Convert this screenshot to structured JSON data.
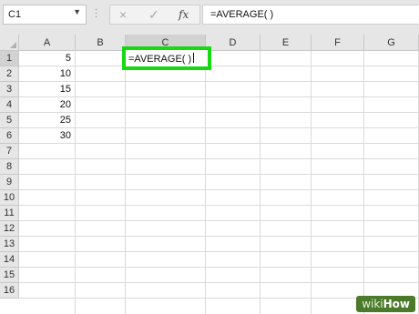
{
  "name_box": {
    "value": "C1"
  },
  "formula_bar": {
    "cancel_icon": "×",
    "enter_icon": "✓",
    "function_icon": "fx",
    "value": "=AVERAGE( )"
  },
  "columns": [
    "A",
    "B",
    "C",
    "D",
    "E",
    "F",
    "G"
  ],
  "rows": [
    "1",
    "2",
    "3",
    "4",
    "5",
    "6",
    "7",
    "8",
    "9",
    "10",
    "11",
    "12",
    "13",
    "14",
    "15",
    "16"
  ],
  "cells": {
    "A1": "5",
    "A2": "10",
    "A3": "15",
    "A4": "20",
    "A5": "25",
    "A6": "30"
  },
  "active_cell": {
    "ref": "C1",
    "text": "=AVERAGE( )"
  },
  "colors": {
    "highlight": "#16d911",
    "header_bg": "#e6e6e6"
  },
  "watermark": {
    "prefix": "wiki",
    "suffix": "How"
  }
}
